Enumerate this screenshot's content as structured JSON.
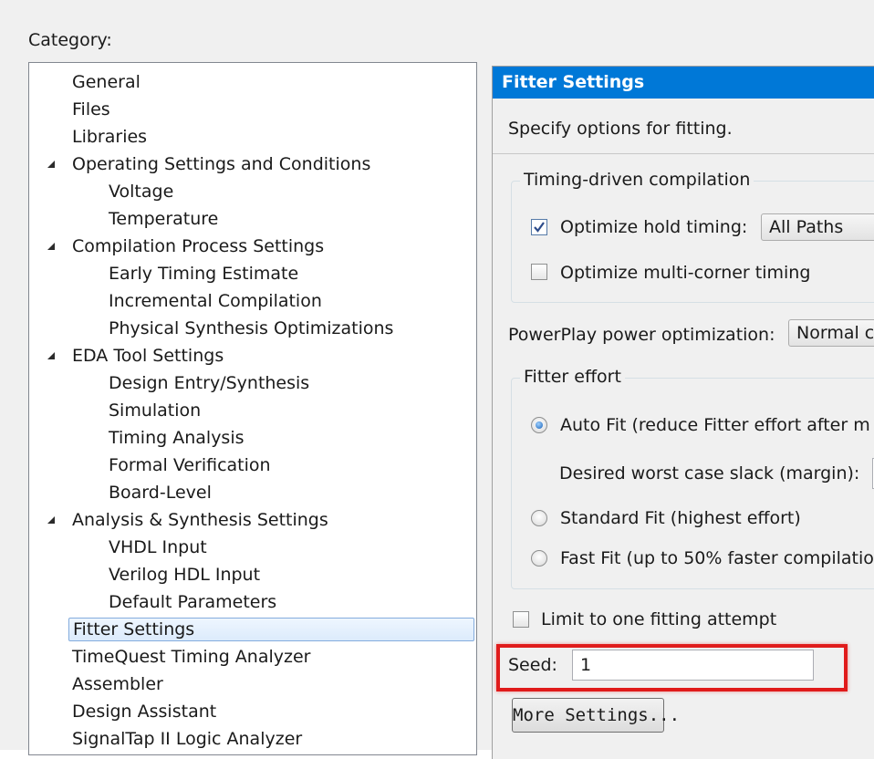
{
  "category_label": "Category:",
  "tree": [
    {
      "label": "General",
      "level": 0
    },
    {
      "label": "Files",
      "level": 0
    },
    {
      "label": "Libraries",
      "level": 0
    },
    {
      "label": "Operating Settings and Conditions",
      "level": 0,
      "expanded": true
    },
    {
      "label": "Voltage",
      "level": 1
    },
    {
      "label": "Temperature",
      "level": 1
    },
    {
      "label": "Compilation Process Settings",
      "level": 0,
      "expanded": true
    },
    {
      "label": "Early Timing Estimate",
      "level": 1
    },
    {
      "label": "Incremental Compilation",
      "level": 1
    },
    {
      "label": "Physical Synthesis Optimizations",
      "level": 1
    },
    {
      "label": "EDA Tool Settings",
      "level": 0,
      "expanded": true
    },
    {
      "label": "Design Entry/Synthesis",
      "level": 1
    },
    {
      "label": "Simulation",
      "level": 1
    },
    {
      "label": "Timing Analysis",
      "level": 1
    },
    {
      "label": "Formal Verification",
      "level": 1
    },
    {
      "label": "Board-Level",
      "level": 1
    },
    {
      "label": "Analysis & Synthesis Settings",
      "level": 0,
      "expanded": true
    },
    {
      "label": "VHDL Input",
      "level": 1
    },
    {
      "label": "Verilog HDL Input",
      "level": 1
    },
    {
      "label": "Default Parameters",
      "level": 1
    },
    {
      "label": "Fitter Settings",
      "level": 0,
      "selected": true
    },
    {
      "label": "TimeQuest Timing Analyzer",
      "level": 0
    },
    {
      "label": "Assembler",
      "level": 0
    },
    {
      "label": "Design Assistant",
      "level": 0
    },
    {
      "label": "SignalTap II Logic Analyzer",
      "level": 0
    }
  ],
  "panel": {
    "title": "Fitter Settings",
    "description": "Specify options for fitting.",
    "timing_group": {
      "legend": "Timing-driven compilation",
      "hold_timing_label": "Optimize hold timing:",
      "hold_timing_checked": true,
      "hold_timing_value": "All Paths",
      "multicorner_label": "Optimize multi-corner timing",
      "multicorner_checked": false
    },
    "powerplay_label": "PowerPlay power optimization:",
    "powerplay_value": "Normal co",
    "effort_group": {
      "legend": "Fitter effort",
      "auto_fit_label": "Auto Fit (reduce Fitter effort after m",
      "slack_label": "Desired worst case slack (margin):",
      "standard_fit_label": "Standard Fit (highest effort)",
      "fast_fit_label": "Fast Fit (up to 50% faster compilatio",
      "selected": "auto_fit"
    },
    "limit_label": "Limit to one fitting attempt",
    "limit_checked": false,
    "seed_label": "Seed:",
    "seed_value": "1",
    "more_settings_label": "More Settings..."
  },
  "colors": {
    "title_bar": "#0078d7",
    "highlight": "#e01b1b",
    "selection_border": "#84acdd"
  },
  "icons": {
    "expander": "expanded-triangle-icon",
    "check": "checkmark-icon",
    "dropdown": "chevron-down-icon"
  }
}
